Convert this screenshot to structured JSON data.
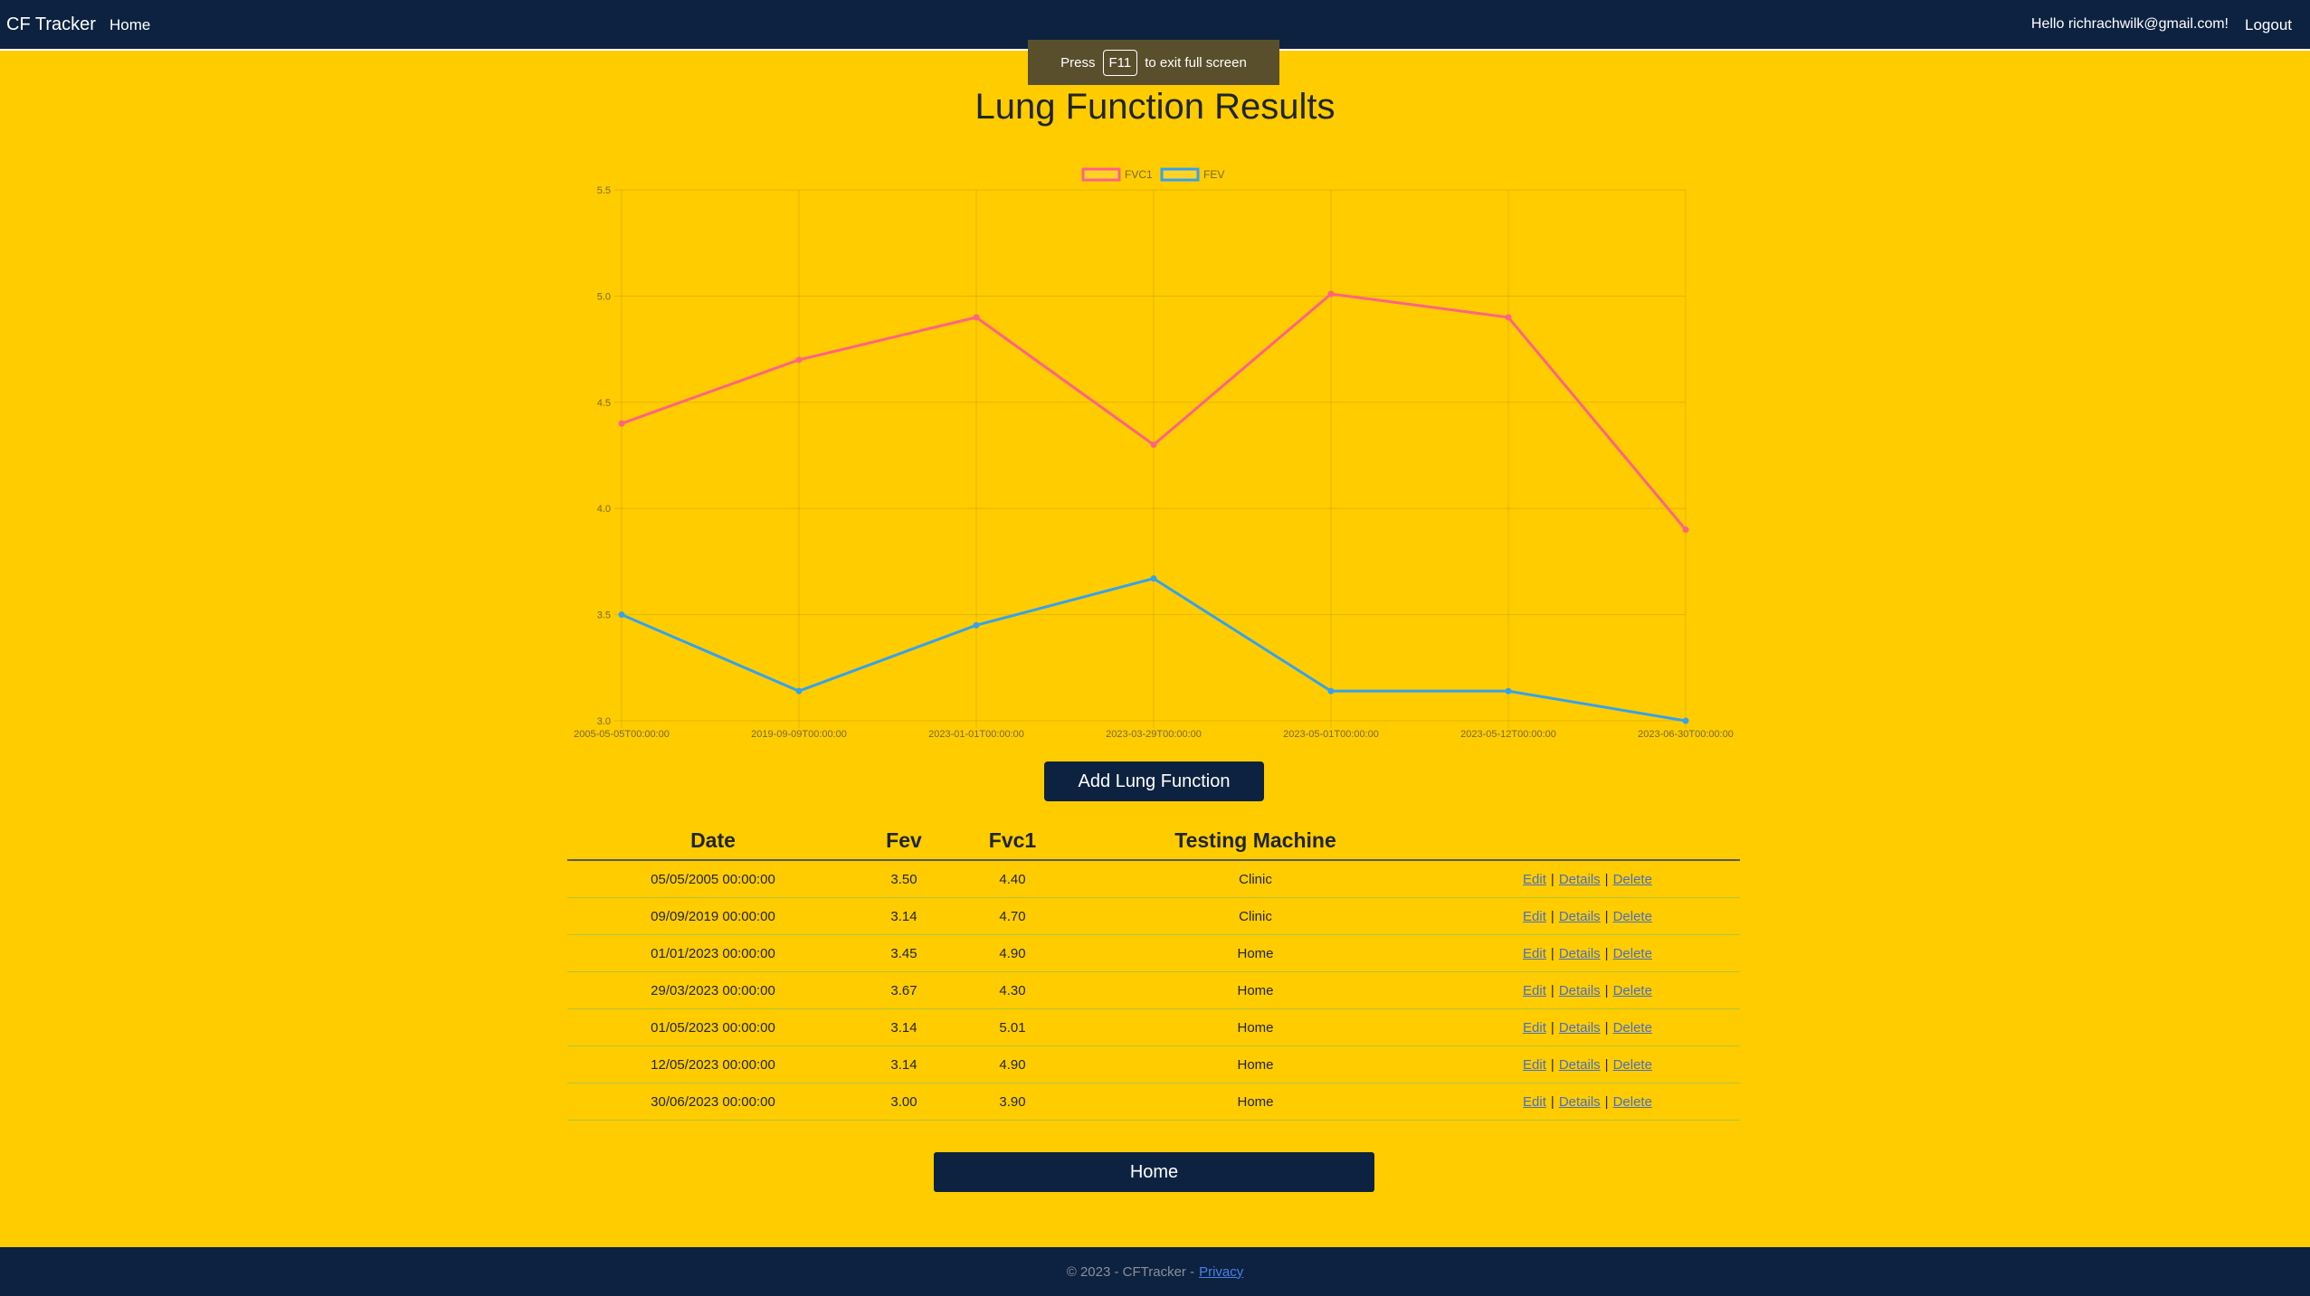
{
  "navbar": {
    "brand": "CF Tracker",
    "home_label": "Home",
    "greeting": "Hello richrachwilk@gmail.com!",
    "logout_label": "Logout"
  },
  "fullscreen_banner": {
    "press": "Press",
    "key": "F11",
    "suffix": "to exit full screen"
  },
  "page": {
    "title": "Lung Function Results",
    "add_button": "Add Lung Function",
    "home_button": "Home"
  },
  "colors": {
    "background": "#ffcc00",
    "navbar": "#0d2240",
    "fvc1_line": "#ff6384",
    "fev_line": "#36a2eb"
  },
  "chart_data": {
    "type": "line",
    "categories": [
      "2005-05-05T00:00:00",
      "2019-09-09T00:00:00",
      "2023-01-01T00:00:00",
      "2023-03-29T00:00:00",
      "2023-05-01T00:00:00",
      "2023-05-12T00:00:00",
      "2023-06-30T00:00:00"
    ],
    "series": [
      {
        "name": "FVC1",
        "values": [
          4.4,
          4.7,
          4.9,
          4.3,
          5.01,
          4.9,
          3.9
        ]
      },
      {
        "name": "FEV",
        "values": [
          3.5,
          3.14,
          3.45,
          3.67,
          3.14,
          3.14,
          3.0
        ]
      }
    ],
    "ylim": [
      3.0,
      5.5
    ],
    "yticks": [
      "3.0",
      "3.5",
      "4.0",
      "4.5",
      "5.0",
      "5.5"
    ],
    "legend": "top-center",
    "grid": true
  },
  "table": {
    "headers": [
      "Date",
      "Fev",
      "Fvc1",
      "Testing Machine",
      ""
    ],
    "rows": [
      {
        "date": "05/05/2005 00:00:00",
        "fev": "3.50",
        "fvc1": "4.40",
        "machine": "Clinic"
      },
      {
        "date": "09/09/2019 00:00:00",
        "fev": "3.14",
        "fvc1": "4.70",
        "machine": "Clinic"
      },
      {
        "date": "01/01/2023 00:00:00",
        "fev": "3.45",
        "fvc1": "4.90",
        "machine": "Home"
      },
      {
        "date": "29/03/2023 00:00:00",
        "fev": "3.67",
        "fvc1": "4.30",
        "machine": "Home"
      },
      {
        "date": "01/05/2023 00:00:00",
        "fev": "3.14",
        "fvc1": "5.01",
        "machine": "Home"
      },
      {
        "date": "12/05/2023 00:00:00",
        "fev": "3.14",
        "fvc1": "4.90",
        "machine": "Home"
      },
      {
        "date": "30/06/2023 00:00:00",
        "fev": "3.00",
        "fvc1": "3.90",
        "machine": "Home"
      }
    ],
    "actions": {
      "edit": "Edit",
      "details": "Details",
      "delete": "Delete",
      "separator": "|"
    }
  },
  "footer": {
    "text": "© 2023 - CFTracker -",
    "privacy": "Privacy"
  }
}
